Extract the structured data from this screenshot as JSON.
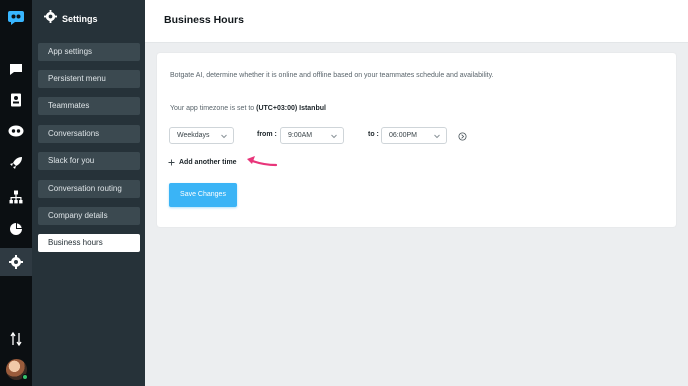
{
  "sidebar": {
    "title": "Settings",
    "items": [
      {
        "label": "App settings"
      },
      {
        "label": "Persistent menu"
      },
      {
        "label": "Teammates"
      },
      {
        "label": "Conversations"
      },
      {
        "label": "Slack for you"
      },
      {
        "label": "Conversation routing"
      },
      {
        "label": "Company details"
      },
      {
        "label": "Business hours",
        "active": true
      }
    ]
  },
  "rail": {
    "icons": [
      "logo-icon",
      "chat-icon",
      "contacts-icon",
      "bot-icon",
      "rocket-icon",
      "hierarchy-icon",
      "pie-chart-icon",
      "gear-icon",
      "sort-icon",
      "avatar"
    ]
  },
  "header": {
    "title": "Business Hours"
  },
  "card": {
    "description": "Botgate AI, determine whether it is online and offline based on your teammates schedule and availability.",
    "timezone_prefix": "Your app timezone is set to ",
    "timezone_value": "(UTC+03:00) Istanbul",
    "schedule": {
      "days_value": "Weekdays",
      "from_label": "from :",
      "from_value": "9:00AM",
      "to_label": "to :",
      "to_value": "06:00PM"
    },
    "add_time_label": "Add another time",
    "save_label": "Save Changes"
  },
  "colors": {
    "accent": "#3ab4f6",
    "annotation_arrow": "#e8357a",
    "sidebar_bg": "#263239",
    "rail_bg": "#0b0f12"
  }
}
